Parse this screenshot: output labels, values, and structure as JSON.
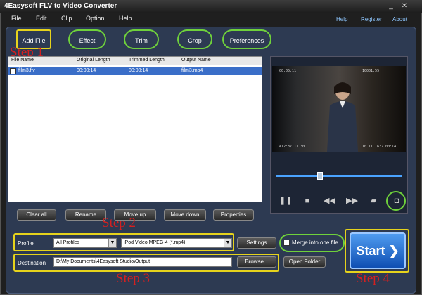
{
  "window": {
    "title": "4Easysoft FLV to Video Converter"
  },
  "menu": {
    "file": "File",
    "edit": "Edit",
    "clip": "Clip",
    "option": "Option",
    "help": "Help"
  },
  "links": {
    "help": "Help",
    "register": "Register",
    "about": "About"
  },
  "toolbar": {
    "add_file": "Add File",
    "effect": "Effect",
    "trim": "Trim",
    "crop": "Crop",
    "preferences": "Preferences"
  },
  "steps": {
    "s1": "Step 1",
    "s2": "Step 2",
    "s3": "Step 3",
    "s4": "Step 4"
  },
  "list": {
    "columns": [
      "File Name",
      "Original Length",
      "Trimmed Length",
      "Output Name"
    ],
    "rows": [
      {
        "checked": true,
        "file": "film3.flv",
        "original": "00:00:14",
        "trimmed": "00:00:14",
        "output": "film3.mp4"
      }
    ]
  },
  "list_buttons": {
    "clear": "Clear all",
    "rename": "Rename",
    "up": "Move up",
    "down": "Move down",
    "props": "Properties"
  },
  "osd": {
    "tl": "00:05:11",
    "tr": "10001.55",
    "bl": "A12:37:11.30",
    "br": "I0.11.1637 00:14"
  },
  "profile": {
    "label": "Profile",
    "category": "All Profiles",
    "format": "iPod Video MPEG-4 (*.mp4)",
    "settings": "Settings"
  },
  "merge": {
    "label": "Merge into one file",
    "checked": false
  },
  "destination": {
    "label": "Destination",
    "path": "D:\\My Documents\\4Easysoft Studio\\Output",
    "browse": "Browse...",
    "open": "Open Folder"
  },
  "start": {
    "label": "Start"
  },
  "player": {
    "seek_fraction": 0.35
  },
  "icons": [
    "minimize-icon",
    "close-icon",
    "pause-icon",
    "stop-icon",
    "rewind-icon",
    "forward-icon",
    "folder-icon",
    "camera-icon",
    "arrow-right-icon"
  ],
  "colors": {
    "highlight_green": "#6fd13b",
    "highlight_yellow": "#e6d31c",
    "step_red": "#d42020",
    "selection": "#3a6ec8",
    "start_blue": "#1f6fd6"
  }
}
